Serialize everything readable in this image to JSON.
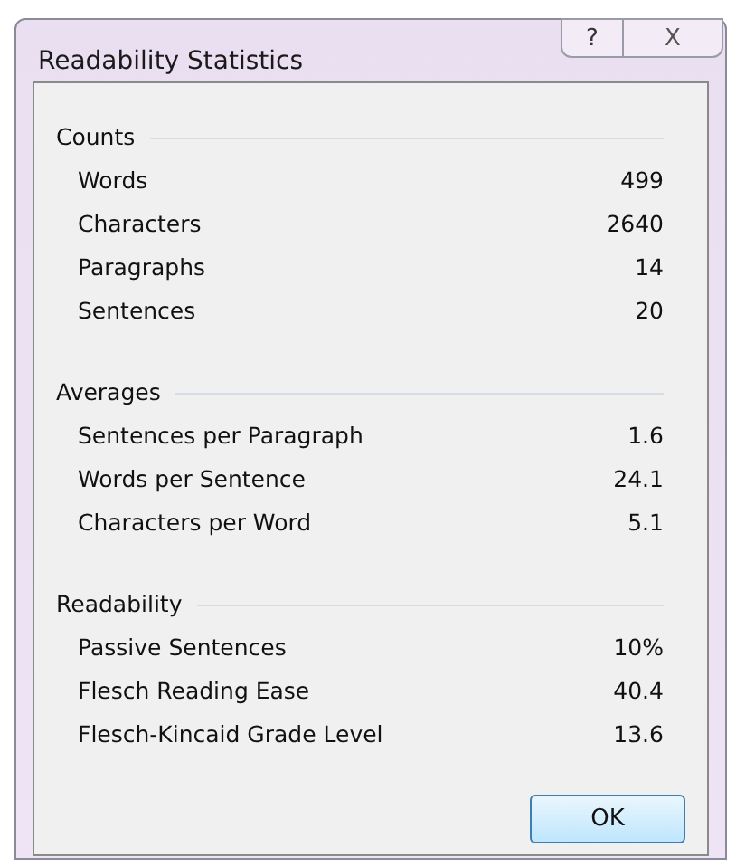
{
  "window": {
    "title": "Readability Statistics",
    "title_buttons": [
      "?",
      "X"
    ]
  },
  "sections": [
    {
      "title": "Counts",
      "rows": [
        {
          "label": "Words",
          "value": "499"
        },
        {
          "label": "Characters",
          "value": "2640"
        },
        {
          "label": "Paragraphs",
          "value": "14"
        },
        {
          "label": "Sentences",
          "value": "20"
        }
      ]
    },
    {
      "title": "Averages",
      "rows": [
        {
          "label": "Sentences per Paragraph",
          "value": "1.6"
        },
        {
          "label": "Words per Sentence",
          "value": "24.1"
        },
        {
          "label": "Characters per Word",
          "value": "5.1"
        }
      ]
    },
    {
      "title": "Readability",
      "rows": [
        {
          "label": "Passive Sentences",
          "value": "10%"
        },
        {
          "label": "Flesch Reading Ease",
          "value": "40.4"
        },
        {
          "label": "Flesch-Kincaid Grade Level",
          "value": "13.6"
        }
      ]
    }
  ],
  "buttons": [
    "OK"
  ]
}
